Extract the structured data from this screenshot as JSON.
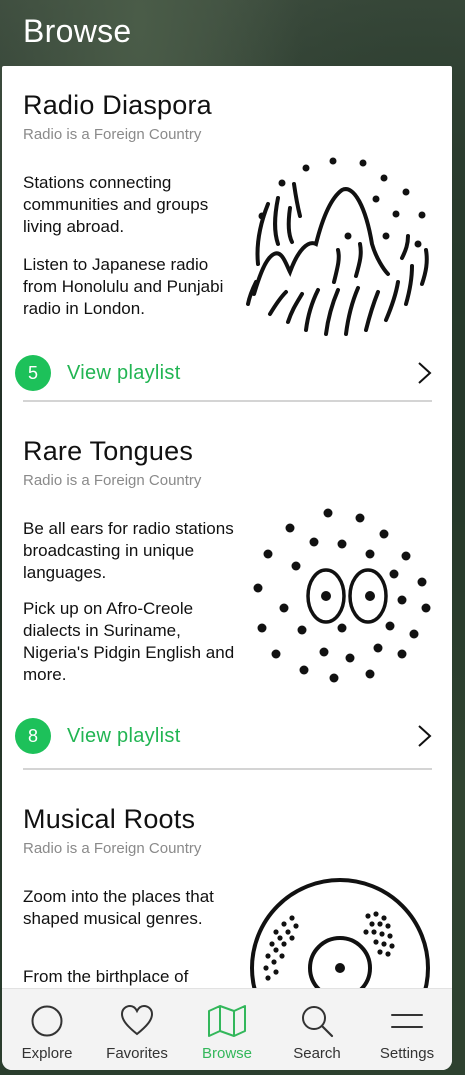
{
  "header": {
    "title": "Browse"
  },
  "cards": [
    {
      "title": "Radio Diaspora",
      "subtitle": "Radio is a Foreign Country",
      "paragraphs": [
        "Stations connecting communities and groups living abroad.",
        "Listen to Japanese radio from Honolulu and Punjabi radio in London."
      ],
      "badge": "5",
      "link_label": "View playlist",
      "illustration": "mountains-icon"
    },
    {
      "title": "Rare Tongues",
      "subtitle": "Radio is a Foreign Country",
      "paragraphs": [
        "Be all ears for radio stations broadcasting in unique languages.",
        "Pick up on Afro-Creole dialects in Suriname, Nigeria's Pidgin English and more."
      ],
      "badge": "8",
      "link_label": "View playlist",
      "illustration": "eyes-dots-icon"
    },
    {
      "title": "Musical Roots",
      "subtitle": "Radio is a Foreign Country",
      "paragraphs": [
        "Zoom into the places that shaped musical genres.",
        "From the birthplace of"
      ],
      "illustration": "vinyl-record-icon"
    }
  ],
  "tabs": [
    {
      "label": "Explore",
      "icon": "circle-icon",
      "active": false
    },
    {
      "label": "Favorites",
      "icon": "heart-icon",
      "active": false
    },
    {
      "label": "Browse",
      "icon": "map-icon",
      "active": true
    },
    {
      "label": "Search",
      "icon": "search-icon",
      "active": false
    },
    {
      "label": "Settings",
      "icon": "menu-icon",
      "active": false
    }
  ],
  "colors": {
    "accent": "#22b553",
    "badge": "#1dc15a",
    "text": "#111111",
    "muted": "#8a8a8a"
  }
}
